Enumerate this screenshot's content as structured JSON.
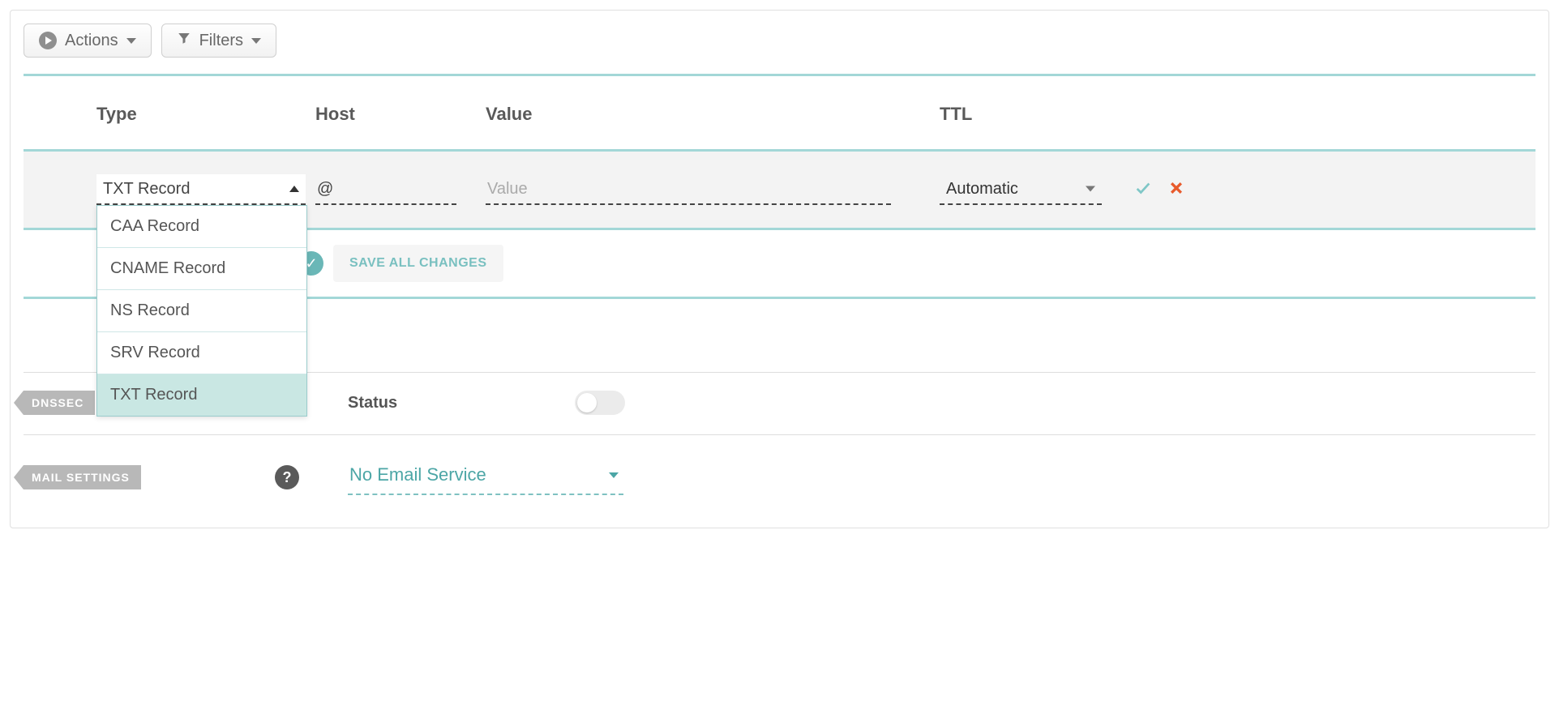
{
  "toolbar": {
    "actions_label": "Actions",
    "filters_label": "Filters"
  },
  "records_table": {
    "headers": {
      "type": "Type",
      "host": "Host",
      "value": "Value",
      "ttl": "TTL"
    },
    "edit_row": {
      "type_selected": "TXT Record",
      "type_options": [
        "CAA Record",
        "CNAME Record",
        "NS Record",
        "SRV Record",
        "TXT Record"
      ],
      "host_value": "@",
      "value_placeholder": "Value",
      "ttl_selected": "Automatic"
    },
    "save_all_label": "SAVE ALL CHANGES"
  },
  "dnssec": {
    "tag": "DNSSEC",
    "status_label": "Status",
    "status_on": false
  },
  "mail": {
    "tag": "MAIL SETTINGS",
    "selected": "No Email Service"
  }
}
